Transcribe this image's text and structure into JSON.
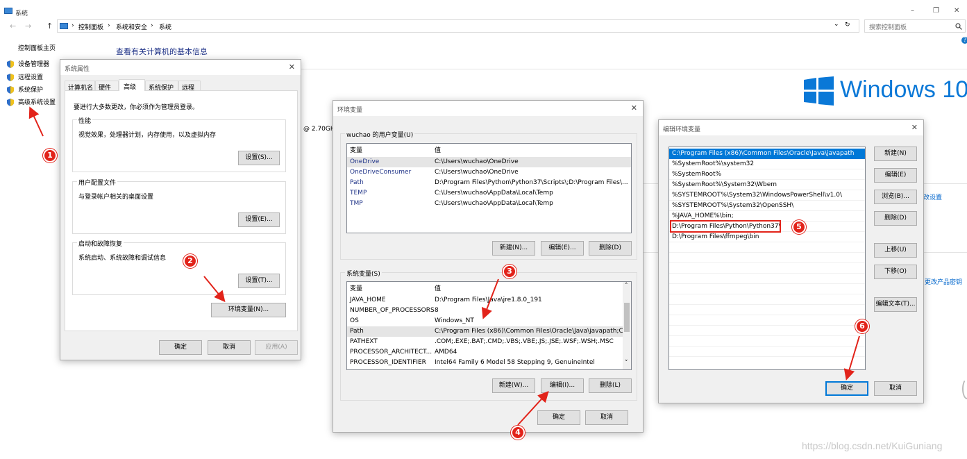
{
  "window": {
    "title": "系统",
    "minimize": "–",
    "restore": "❐",
    "close": "✕"
  },
  "address": {
    "nav_back": "←",
    "nav_forward": "→",
    "nav_up": "↑",
    "crumbs": [
      "控制面板",
      "系统和安全",
      "系统"
    ],
    "sep": "›",
    "dropdown": "⌄",
    "refresh": "↻"
  },
  "search": {
    "placeholder": "搜索控制面板",
    "icon": "search-icon"
  },
  "sidebar": {
    "home": "控制面板主页",
    "items": [
      {
        "label": "设备管理器",
        "icon": "shield-icon"
      },
      {
        "label": "远程设置",
        "icon": "shield-icon"
      },
      {
        "label": "系统保护",
        "icon": "shield-icon"
      },
      {
        "label": "高级系统设置",
        "icon": "shield-icon"
      }
    ]
  },
  "main": {
    "heading": "查看有关计算机的基本信息",
    "help": "?",
    "cpu_partial": "@ 2.70GH",
    "link1": "改设置",
    "link2": "更改产品密钥",
    "windows_logo_text": "Windows 10"
  },
  "sysprop": {
    "title": "系统属性",
    "tabs": [
      "计算机名",
      "硬件",
      "高级",
      "系统保护",
      "远程"
    ],
    "admin_note": "要进行大多数更改，你必须作为管理员登录。",
    "perf": {
      "label": "性能",
      "desc": "视觉效果，处理器计划，内存使用，以及虚拟内存",
      "btn": "设置(S)..."
    },
    "profile": {
      "label": "用户配置文件",
      "desc": "与登录帐户相关的桌面设置",
      "btn": "设置(E)..."
    },
    "startup": {
      "label": "启动和故障恢复",
      "desc": "系统启动、系统故障和调试信息",
      "btn": "设置(T)..."
    },
    "env_btn": "环境变量(N)...",
    "ok": "确定",
    "cancel": "取消",
    "apply": "应用(A)"
  },
  "envvars": {
    "title": "环境变量",
    "user_label": "wuchao 的用户变量(U)",
    "col_var": "变量",
    "col_val": "值",
    "user_rows": [
      {
        "k": "OneDrive",
        "v": "C:\\Users\\wuchao\\OneDrive"
      },
      {
        "k": "OneDriveConsumer",
        "v": "C:\\Users\\wuchao\\OneDrive"
      },
      {
        "k": "Path",
        "v": "D:\\Program Files\\Python\\Python37\\Scripts\\;D:\\Program Files\\..."
      },
      {
        "k": "TEMP",
        "v": "C:\\Users\\wuchao\\AppData\\Local\\Temp"
      },
      {
        "k": "TMP",
        "v": "C:\\Users\\wuchao\\AppData\\Local\\Temp"
      }
    ],
    "user_new": "新建(N)...",
    "user_edit": "编辑(E)...",
    "user_delete": "删除(D)",
    "sys_label": "系统变量(S)",
    "sys_rows": [
      {
        "k": "JAVA_HOME",
        "v": "D:\\Program Files\\Java\\jre1.8.0_191"
      },
      {
        "k": "NUMBER_OF_PROCESSORS",
        "v": "8"
      },
      {
        "k": "OS",
        "v": "Windows_NT"
      },
      {
        "k": "Path",
        "v": "C:\\Program Files (x86)\\Common Files\\Oracle\\Java\\javapath;C:..."
      },
      {
        "k": "PATHEXT",
        "v": ".COM;.EXE;.BAT;.CMD;.VBS;.VBE;.JS;.JSE;.WSF;.WSH;.MSC"
      },
      {
        "k": "PROCESSOR_ARCHITECT...",
        "v": "AMD64"
      },
      {
        "k": "PROCESSOR_IDENTIFIER",
        "v": "Intel64 Family 6 Model 58 Stepping 9, GenuineIntel"
      }
    ],
    "sys_new": "新建(W)...",
    "sys_edit": "编辑(I)...",
    "sys_delete": "删除(L)",
    "ok": "确定",
    "cancel": "取消",
    "scroll_up": "˄",
    "scroll_down": "˅"
  },
  "editenv": {
    "title": "编辑环境变量",
    "entries": [
      "C:\\Program Files (x86)\\Common Files\\Oracle\\Java\\javapath",
      "%SystemRoot%\\system32",
      "%SystemRoot%",
      "%SystemRoot%\\System32\\Wbem",
      "%SYSTEMROOT%\\System32\\WindowsPowerShell\\v1.0\\",
      "%SYSTEMROOT%\\System32\\OpenSSH\\",
      "%JAVA_HOME%\\bin;",
      "D:\\Program Files\\Python\\Python37\\",
      "D:\\Program Files\\ffmpeg\\bin"
    ],
    "new": "新建(N)",
    "edit": "编辑(E)",
    "browse": "浏览(B)...",
    "delete": "删除(D)",
    "up": "上移(U)",
    "down": "下移(O)",
    "edit_text": "编辑文本(T)...",
    "ok": "确定",
    "cancel": "取消"
  },
  "markers": [
    "1",
    "2",
    "3",
    "4",
    "5",
    "6"
  ],
  "watermark": "https://blog.csdn.net/KuiGuniang",
  "colors": {
    "accent": "#0078d7",
    "marker": "#e2231a",
    "link": "#0066cc"
  }
}
